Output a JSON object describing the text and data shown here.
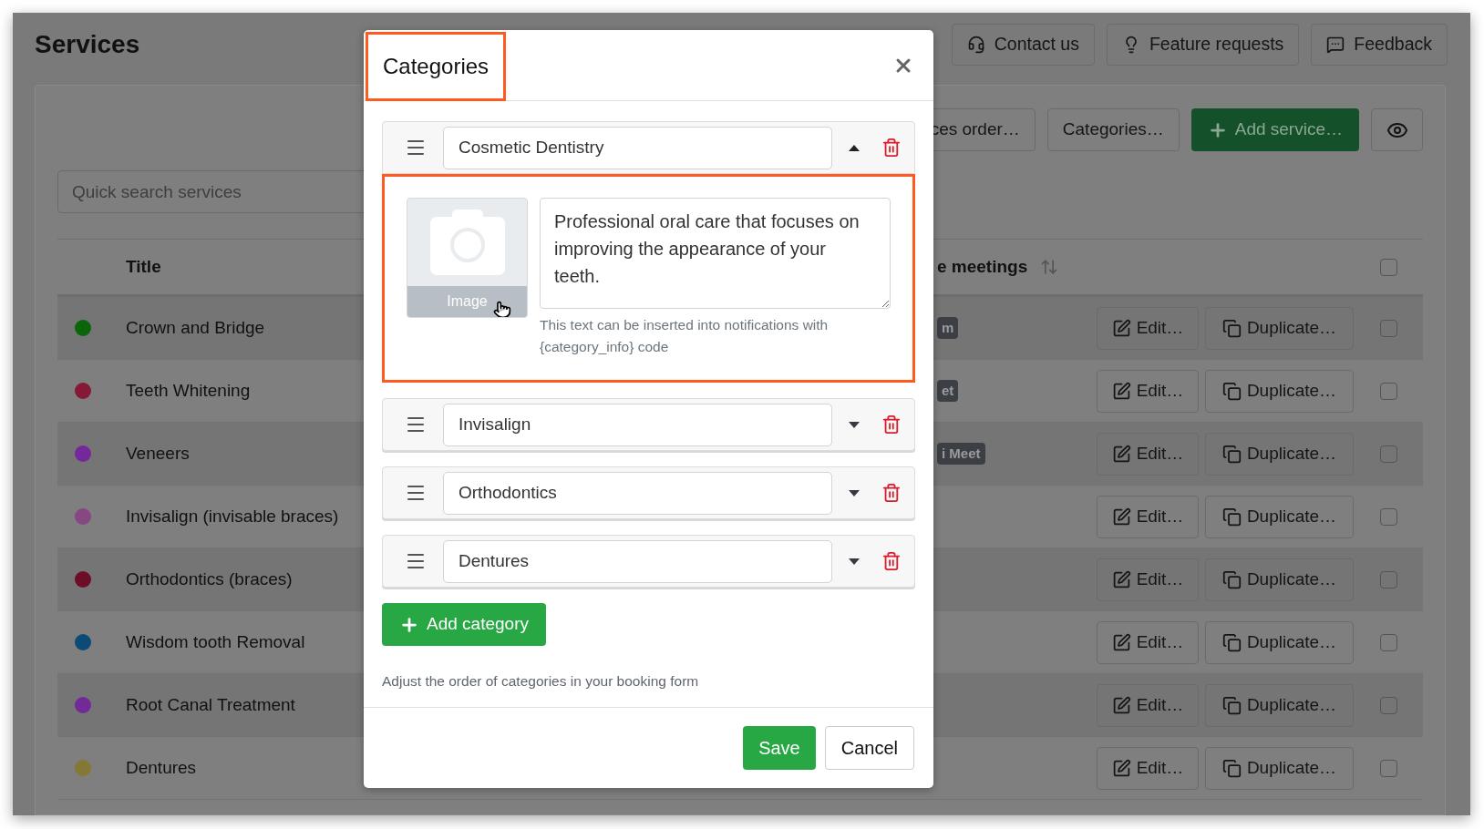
{
  "page": {
    "title": "Services"
  },
  "top_buttons": [
    {
      "label": "Contact us",
      "kind": "headset"
    },
    {
      "label": "Feature requests",
      "kind": "bulb"
    },
    {
      "label": "Feedback",
      "kind": "chat"
    }
  ],
  "toolbar": [
    {
      "label": "ces order…",
      "kind": "clipped"
    },
    {
      "label": "Categories…",
      "kind": "plain"
    },
    {
      "label": "Add service…",
      "kind": "primary"
    },
    {
      "kind": "eye"
    }
  ],
  "search": {
    "placeholder": "Quick search services"
  },
  "table": {
    "columns": [
      "Title",
      "e meetings"
    ],
    "select_all_checked": false,
    "rows": [
      {
        "title": "Crown and Bridge",
        "color": "#0b650b",
        "badge": "m",
        "actions": [
          "Edit…",
          "Duplicate…"
        ],
        "checked": false
      },
      {
        "title": "Teeth Whitening",
        "color": "#861a36",
        "badge": "et",
        "actions": [
          "Edit…",
          "Duplicate…"
        ],
        "checked": false
      },
      {
        "title": "Veneers",
        "color": "#74289a",
        "badge": "i Meet",
        "actions": [
          "Edit…",
          "Duplicate…"
        ],
        "checked": false
      },
      {
        "title": "Invisalign (invisable braces)",
        "color": "#864782",
        "actions": [
          "Edit…",
          "Duplicate…"
        ],
        "checked": false
      },
      {
        "title": "Orthodontics (braces)",
        "color": "#6c0e28",
        "actions": [
          "Edit…",
          "Duplicate…"
        ],
        "checked": false
      },
      {
        "title": "Wisdom tooth Removal",
        "color": "#0c4a78",
        "actions": [
          "Edit…",
          "Duplicate…"
        ],
        "checked": false
      },
      {
        "title": "Root Canal Treatment",
        "color": "#712a98",
        "actions": [
          "Edit…",
          "Duplicate…"
        ],
        "checked": false
      },
      {
        "title": "Dentures",
        "color": "#857834",
        "actions": [
          "Edit…",
          "Duplicate…"
        ],
        "checked": false
      }
    ]
  },
  "modal": {
    "title": "Categories",
    "title_highlighted": true,
    "categories": [
      {
        "name": "Cosmetic Dentistry",
        "expanded": true,
        "details": {
          "highlighted": true,
          "image_label": "Image",
          "description": "Professional oral care that focuses on improving the appearance of your teeth.",
          "help": "This text can be inserted into notifications with {category_info} code"
        }
      },
      {
        "name": "Invisalign",
        "expanded": false
      },
      {
        "name": "Orthodontics",
        "expanded": false
      },
      {
        "name": "Dentures",
        "expanded": false
      }
    ],
    "add_button": "Add category",
    "hint": "Adjust the order of categories in your booking form",
    "buttons": [
      {
        "label": "Save",
        "kind": "primary"
      },
      {
        "label": "Cancel",
        "kind": "secondary"
      }
    ]
  }
}
